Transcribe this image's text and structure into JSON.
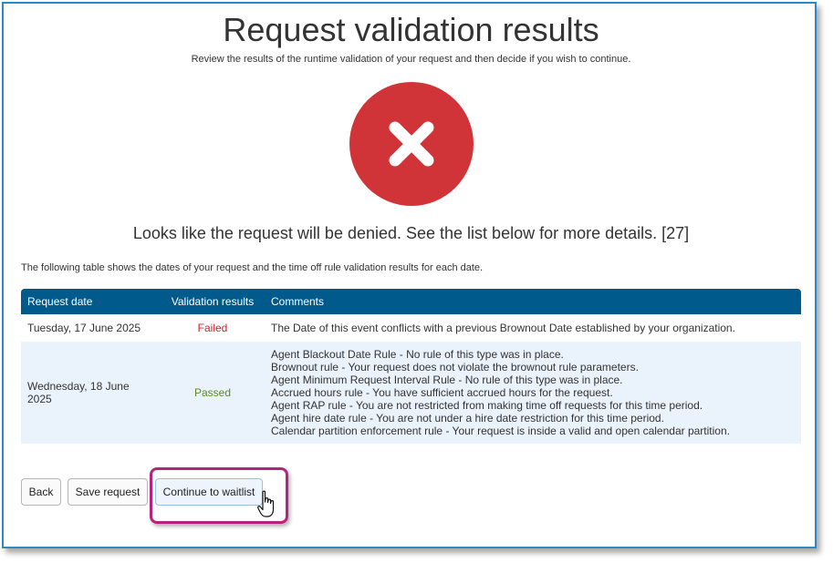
{
  "page": {
    "title": "Request validation results",
    "subtitle": "Review the results of the runtime validation of your request and then decide if you wish to continue.",
    "status_icon": "error-x-icon",
    "status_color": "#d13438",
    "message": "Looks like the request will be denied. See the list below for more details. [27]",
    "intro": "The following table shows the dates of your request and the time off rule validation results for each date."
  },
  "table": {
    "header_color": "#005a8c",
    "headers": {
      "date": "Request date",
      "results": "Validation results",
      "comments": "Comments"
    },
    "rows": [
      {
        "date": "Tuesday, 17 June 2025",
        "result": "Failed",
        "comments": [
          "The Date of this event conflicts with a previous Brownout Date established by your organization."
        ]
      },
      {
        "date": "Wednesday, 18 June 2025",
        "result": "Passed",
        "comments": [
          "Agent Blackout Date Rule - No rule of this type was in place.",
          "Brownout rule - Your request does not violate the brownout rule parameters.",
          "Agent Minimum Request Interval Rule - No rule of this type was in place.",
          "Accrued hours rule - You have sufficient accrued hours for the request.",
          "Agent RAP rule - You are not restricted from making time off requests for this time period.",
          "Agent hire date rule - You are not under a hire date restriction for this time period.",
          "Calendar partition enforcement rule - Your request is inside a valid and open calendar partition."
        ]
      }
    ]
  },
  "buttons": {
    "back": "Back",
    "save": "Save request",
    "continue": "Continue to waitlist"
  },
  "colors": {
    "failed": "#c4262e",
    "passed": "#5b8c20",
    "highlight": "#b4237e",
    "frame": "#2f88c6"
  }
}
